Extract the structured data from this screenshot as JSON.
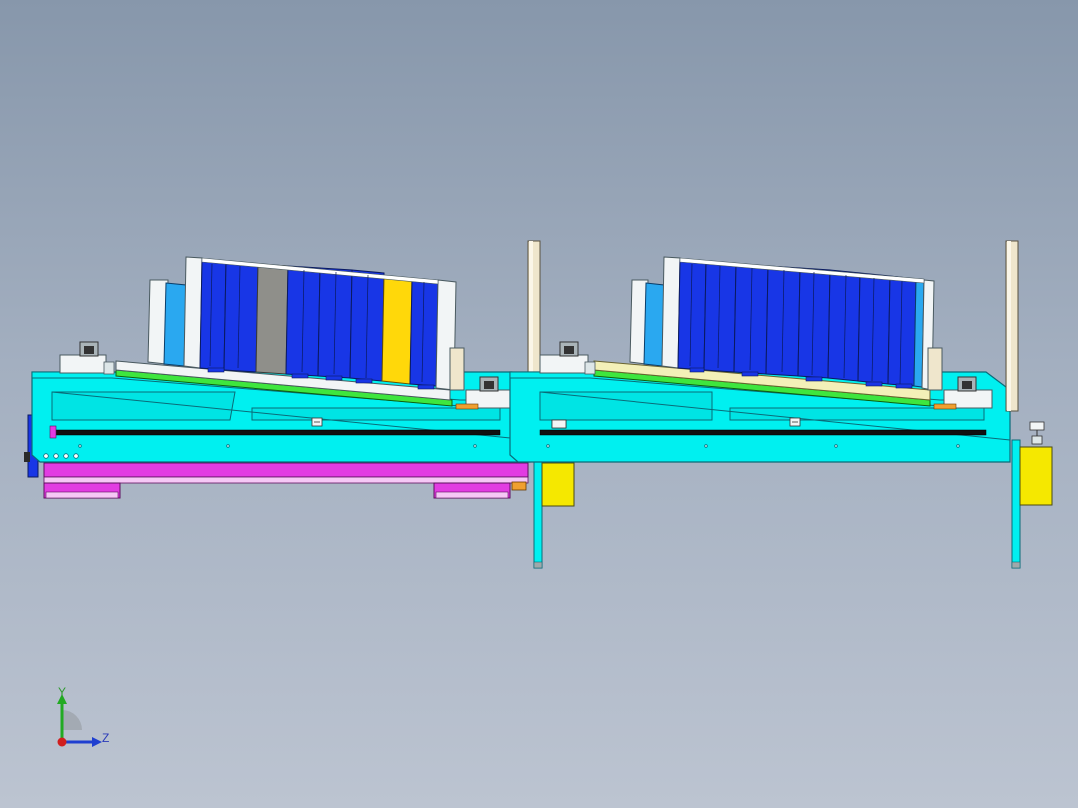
{
  "view": {
    "background_top": "#8797ab",
    "background_bottom": "#bcc4d1"
  },
  "triad": {
    "y_label": "Y",
    "z_label": "Z",
    "y_color": "#22aa22",
    "z_color": "#1f3fd0",
    "x_color": "#d01f1f"
  },
  "colors": {
    "frame": "#00f0f0",
    "frame_edge": "#0a6b78",
    "cell_blue": "#1836e6",
    "cell_gray": "#8f8f8a",
    "cell_yellow": "#ffd80a",
    "rail_green": "#3ee63e",
    "magenta": "#e23ce2",
    "post": "#efe6cc",
    "pale_yellow": "#f3f0b8",
    "block_yellow": "#f5e800",
    "light_blue": "#2aa8f0",
    "white_part": "#f2f5f6"
  }
}
